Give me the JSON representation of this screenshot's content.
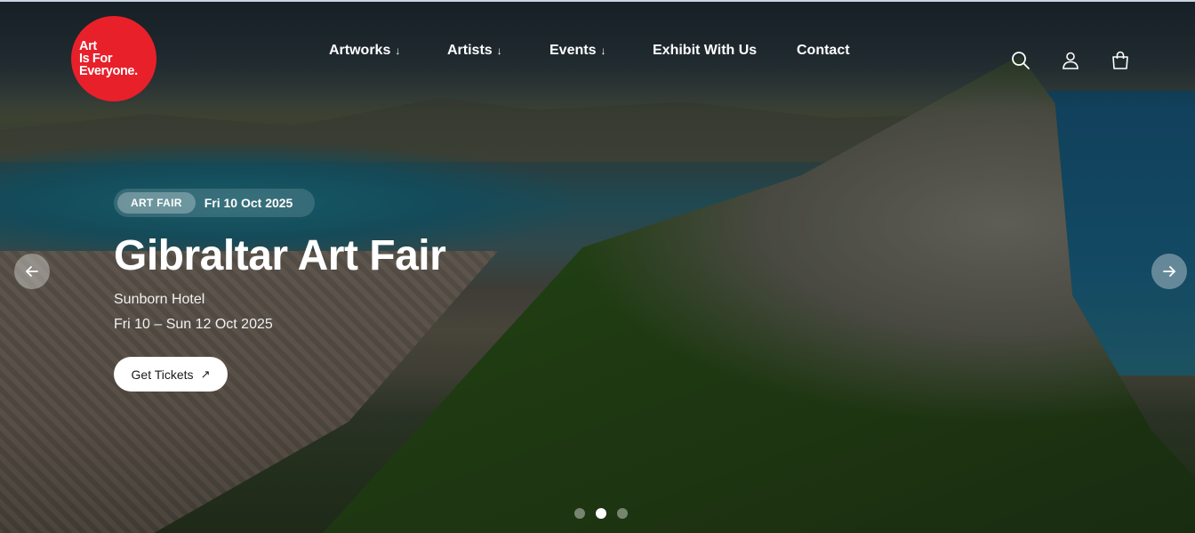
{
  "brand": {
    "logo_line1": "Art",
    "logo_line2": "Is For",
    "logo_line3": "Everyone.",
    "logo_color": "#e8202a"
  },
  "nav": {
    "items": [
      {
        "label": "Artworks",
        "has_dropdown": true,
        "arrow": "↓"
      },
      {
        "label": "Artists",
        "has_dropdown": true,
        "arrow": "↓"
      },
      {
        "label": "Events",
        "has_dropdown": true,
        "arrow": "↓"
      },
      {
        "label": "Exhibit With Us",
        "has_dropdown": false
      },
      {
        "label": "Contact",
        "has_dropdown": false
      }
    ]
  },
  "header_icons": [
    "search-icon",
    "user-icon",
    "shopping-bag-icon"
  ],
  "hero": {
    "badge": "ART FAIR",
    "badge_date": "Fri 10 Oct 2025",
    "title": "Gibraltar Art Fair",
    "venue": "Sunborn Hotel",
    "dates": "Fri 10 – Sun 12 Oct 2025",
    "cta_label": "Get Tickets",
    "cta_icon": "↗"
  },
  "slider": {
    "prev_icon": "←",
    "next_icon": "→",
    "slide_count": 3,
    "active_slide": 2
  }
}
